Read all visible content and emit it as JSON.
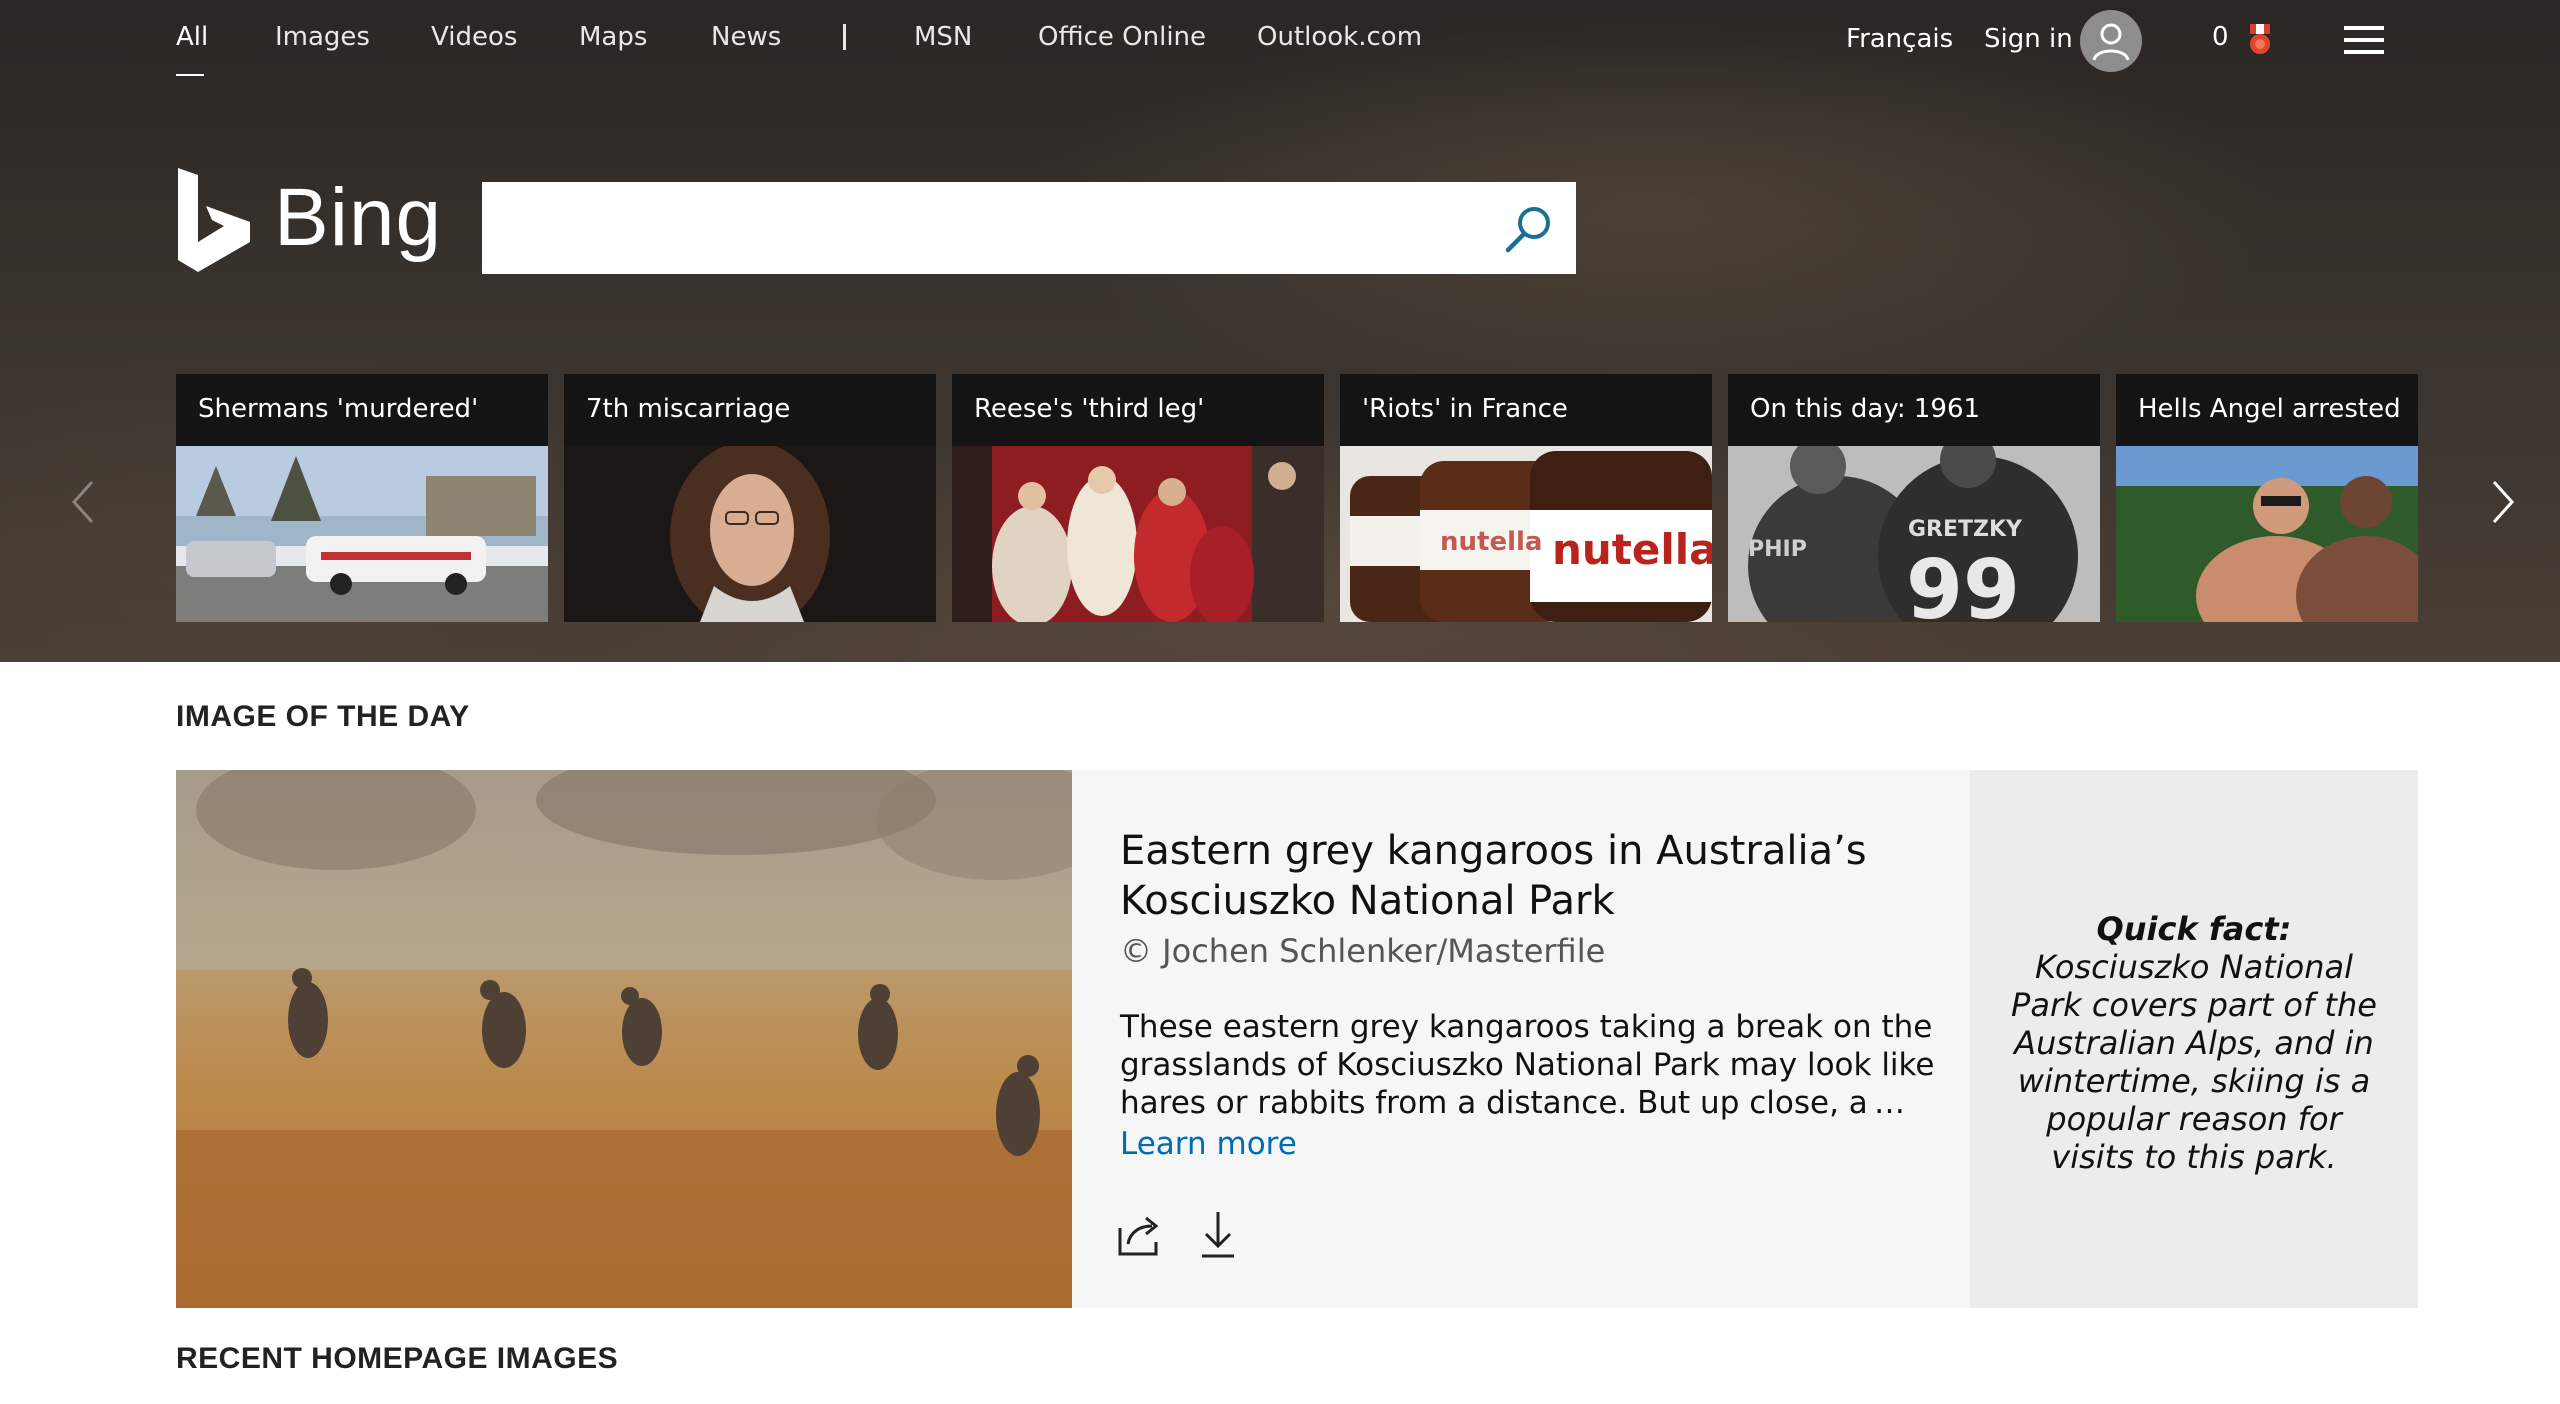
{
  "nav": {
    "items": [
      "All",
      "Images",
      "Videos",
      "Maps",
      "News"
    ],
    "separator": "|",
    "links": [
      "MSN",
      "Office Online",
      "Outlook.com"
    ]
  },
  "header_tools": {
    "language": "Français",
    "sign_in": "Sign in",
    "rewards_count": "0",
    "icons": [
      "avatar-icon",
      "rewards-medal-icon",
      "hamburger-menu-icon"
    ]
  },
  "logo": {
    "text": "Bing"
  },
  "search": {
    "value": "",
    "placeholder": "",
    "icon": "search-icon"
  },
  "carousel": {
    "tiles": [
      {
        "title": "Shermans 'murdered'"
      },
      {
        "title": "7th miscarriage"
      },
      {
        "title": "Reese's 'third leg'"
      },
      {
        "title": "'Riots' in France"
      },
      {
        "title": "On this day: 1961"
      },
      {
        "title": "Hells Angel arrested"
      }
    ],
    "icons": [
      "chevron-left-icon",
      "chevron-right-icon"
    ]
  },
  "image_of_the_day": {
    "section_title": "IMAGE OF THE DAY",
    "title": "Eastern grey kangaroos in Australia’s Kosciuszko National Park",
    "credit": "© Jochen Schlenker/Masterfile",
    "description": "These eastern grey kangaroos taking a break on the grasslands of Kosciuszko National Park may look like hares or rabbits from a distance. But up close, a …",
    "learn_more": "Learn more",
    "quick_fact_title": "Quick fact:",
    "quick_fact_text": "Kosciuszko National Park covers part of the Australian Alps, and in wintertime, skiing is a popular reason for visits to this park.",
    "icons": [
      "share-icon",
      "download-icon"
    ]
  },
  "recent": {
    "section_title": "RECENT HOMEPAGE IMAGES"
  },
  "colors": {
    "link": "#006cb4",
    "hero_bg": "#36302b",
    "tile_bg": "#141414"
  }
}
